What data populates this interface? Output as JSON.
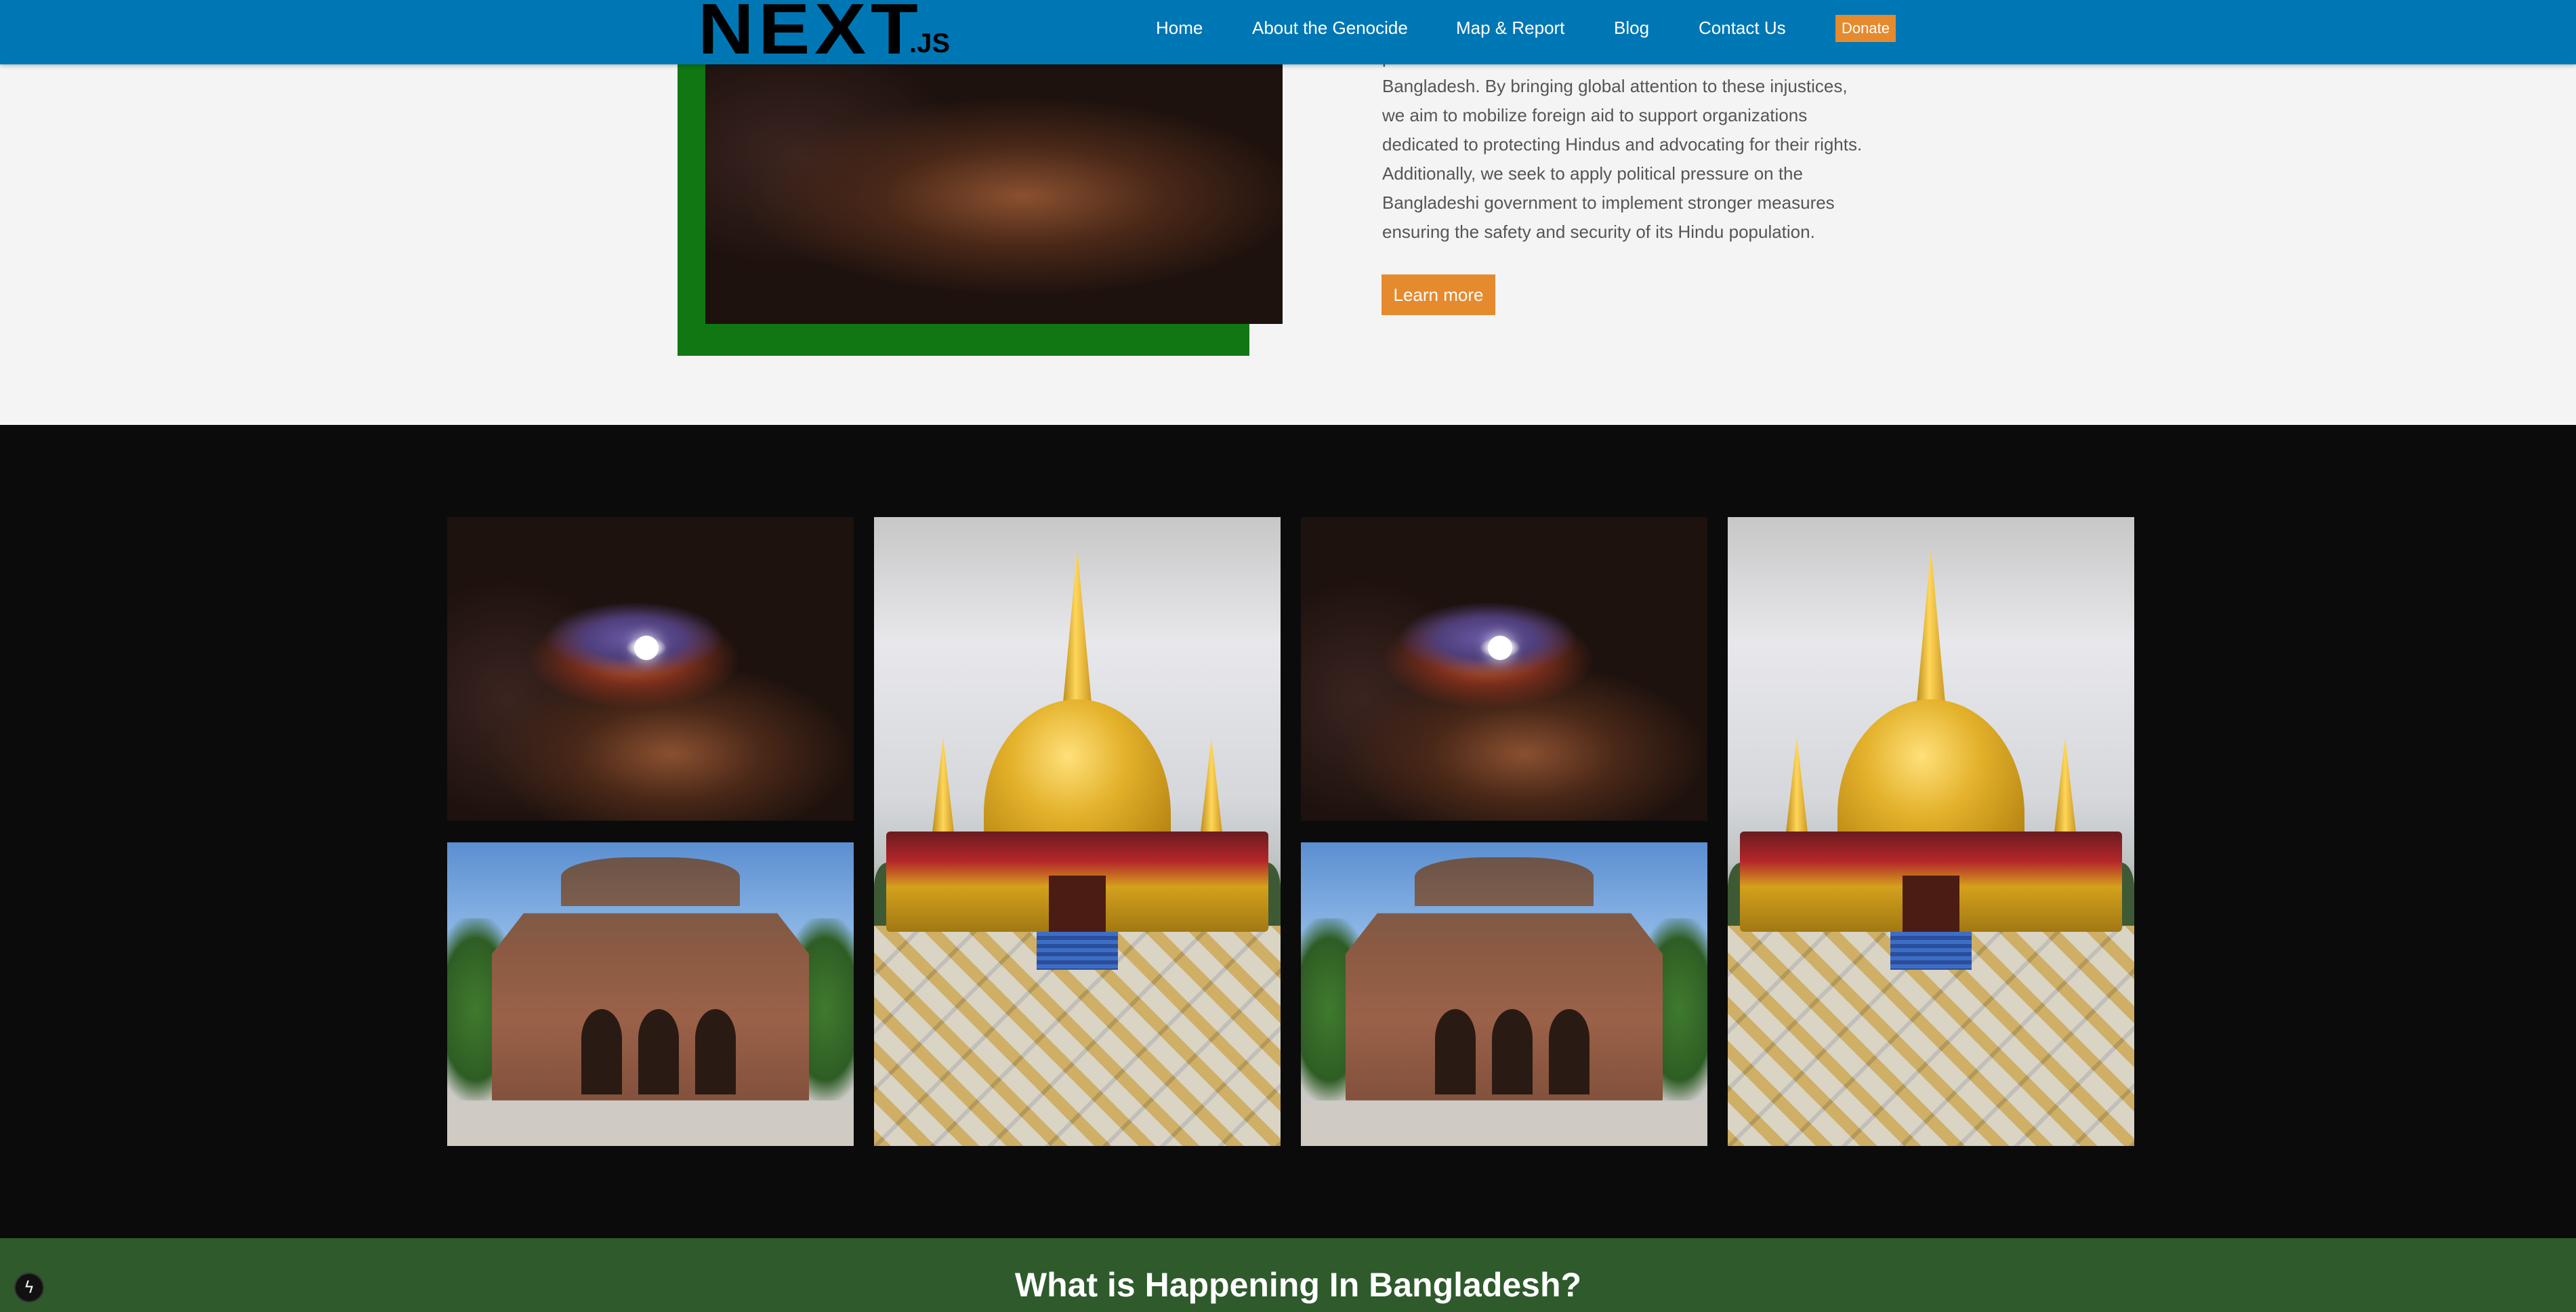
{
  "header": {
    "logo_text": "NEXT",
    "logo_suffix": ".JS",
    "nav": [
      "Home",
      "About the Genocide",
      "Map & Report",
      "Blog",
      "Contact Us"
    ],
    "donate_label": "Donate",
    "colors": {
      "bar": "#0077b5",
      "donate": "#e68a2e"
    }
  },
  "intro": {
    "paragraph_lines": [
      "persecution and destruction of Hindu communities in",
      "Bangladesh. By bringing global attention to these injustices,",
      "we aim to mobilize foreign aid to support organizations",
      "dedicated to protecting Hindus and advocating for their rights.",
      "Additionally, we seek to apply political pressure on the",
      "Bangladeshi government to implement stronger measures",
      "ensuring the safety and security of its Hindu population."
    ],
    "learn_more_label": "Learn more",
    "accent_color": "#117712"
  },
  "gallery": {
    "images": [
      "oil-lamp-photo",
      "terracotta-temple-photo",
      "golden-pagoda-photo",
      "oil-lamp-photo",
      "terracotta-temple-photo",
      "golden-pagoda-photo"
    ]
  },
  "section": {
    "heading": "What is Happening In Bangladesh?",
    "background": "#2e5a2c"
  },
  "dev_indicator": {
    "icon": "lightning-icon",
    "glyph": "ϟ"
  }
}
